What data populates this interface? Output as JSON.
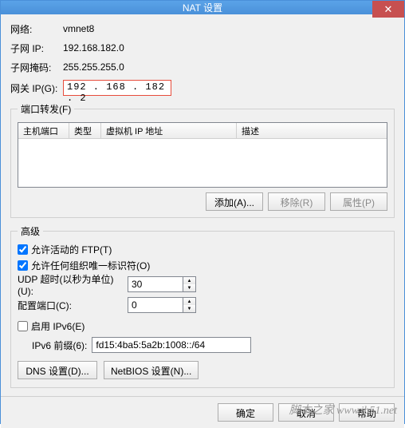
{
  "window": {
    "title": "NAT 设置",
    "close_label": "✕"
  },
  "info": {
    "network_lbl": "网络:",
    "network_val": "vmnet8",
    "subnet_lbl": "子网 IP:",
    "subnet_val": "192.168.182.0",
    "mask_lbl": "子网掩码:",
    "mask_val": "255.255.255.0",
    "gateway_lbl": "网关 IP(G):",
    "gateway_val": "192 . 168 . 182 .  2"
  },
  "portfwd": {
    "legend": "端口转发(F)",
    "cols": {
      "host": "主机端口",
      "type": "类型",
      "vmip": "虚拟机 IP 地址",
      "desc": "描述"
    },
    "add": "添加(A)...",
    "remove": "移除(R)",
    "props": "属性(P)"
  },
  "adv": {
    "legend": "高级",
    "ftp": "允许活动的 FTP(T)",
    "org": "允许任何组织唯一标识符(O)",
    "udp_lbl": "UDP 超时(以秒为单位)(U):",
    "udp_val": "30",
    "port_lbl": "配置端口(C):",
    "port_val": "0",
    "ipv6_enable": "启用 IPv6(E)",
    "ipv6_prefix_lbl": "IPv6 前缀(6):",
    "ipv6_prefix_val": "fd15:4ba5:5a2b:1008::/64",
    "dns_btn": "DNS 设置(D)...",
    "netbios_btn": "NetBIOS 设置(N)..."
  },
  "footer": {
    "ok": "确定",
    "cancel": "取消",
    "help": "帮助"
  },
  "watermark": "脚本之家 www.jb51.net"
}
